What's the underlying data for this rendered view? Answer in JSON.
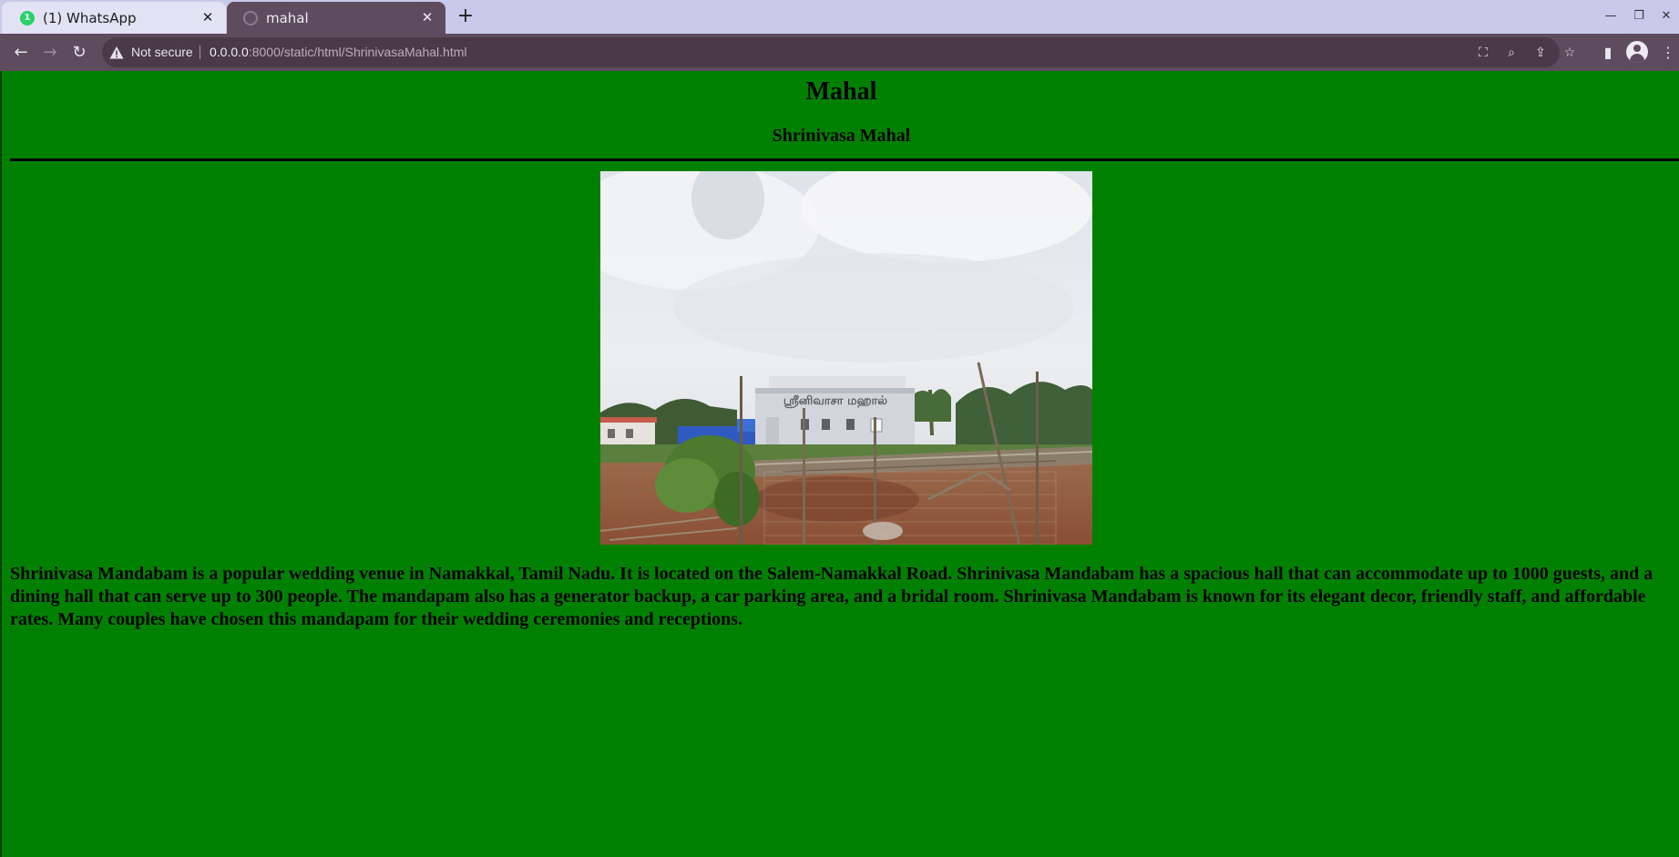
{
  "browser": {
    "tabs": [
      {
        "label": "(1) WhatsApp",
        "badge": "1"
      },
      {
        "label": "mahal"
      }
    ],
    "address": {
      "security_label": "Not secure",
      "url_host": "0.0.0.0",
      "url_rest": ":8000/static/html/ShrinivasaMahal.html"
    }
  },
  "page": {
    "heading": "Mahal",
    "subheading": "Shrinivasa Mahal",
    "photo_signboard": "ஸ்ரீனிவாசா மஹால்",
    "description": "Shrinivasa Mandabam is a popular wedding venue in Namakkal, Tamil Nadu. It is located on the Salem-Namakkal Road. Shrinivasa Mandabam has a spacious hall that can accommodate up to 1000 guests, and a dining hall that can serve up to 300 people. The mandapam also has a generator backup, a car parking area, and a bridal room. Shrinivasa Mandabam is known for its elegant decor, friendly staff, and affordable rates. Many couples have chosen this mandapam for their wedding ceremonies and receptions."
  },
  "colors": {
    "page_background": "#008000",
    "toolbar": "#5e4b5d",
    "tabstrip": "#c9c9eb"
  }
}
